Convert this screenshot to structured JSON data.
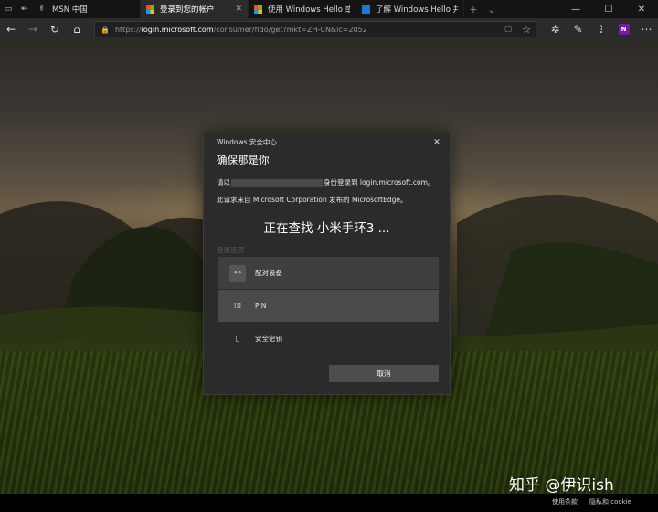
{
  "tabs": [
    {
      "label": "MSN 中国",
      "favicon": "msn-icon"
    },
    {
      "label": "登录到您的帐户",
      "favicon": "microsoft-logo-icon",
      "active": true
    },
    {
      "label": "使用 Windows Hello 或安全",
      "favicon": "microsoft-logo-icon"
    },
    {
      "label": "了解 Windows Hello 并对其",
      "favicon": "windows-logo-icon"
    }
  ],
  "address_bar": {
    "url_prefix": "https://",
    "url_host": "login.microsoft.com",
    "url_rest": "/consumer/fido/get?mkt=ZH-CN&lc=2052"
  },
  "dialog": {
    "header": "Windows 安全中心",
    "title": "确保那是你",
    "line1_before": "请以",
    "line1_after": "身份登录到 login.microsoft.com。",
    "line2": "此请求来自 Microsoft Corporation 发布的 MicrosoftEdge。",
    "status": "正在查找 小米手环3 ...",
    "options_label": "登录选项",
    "options": [
      {
        "label": "配对设备",
        "icon": "paired-device-icon"
      },
      {
        "label": "PIN",
        "icon": "pin-keypad-icon"
      },
      {
        "label": "安全密钥",
        "icon": "usb-security-key-icon"
      }
    ],
    "cancel_label": "取消"
  },
  "watermark": "知乎 @伊识ish",
  "footer": {
    "link1": "使用条款",
    "link2": "隐私和 cookie"
  }
}
